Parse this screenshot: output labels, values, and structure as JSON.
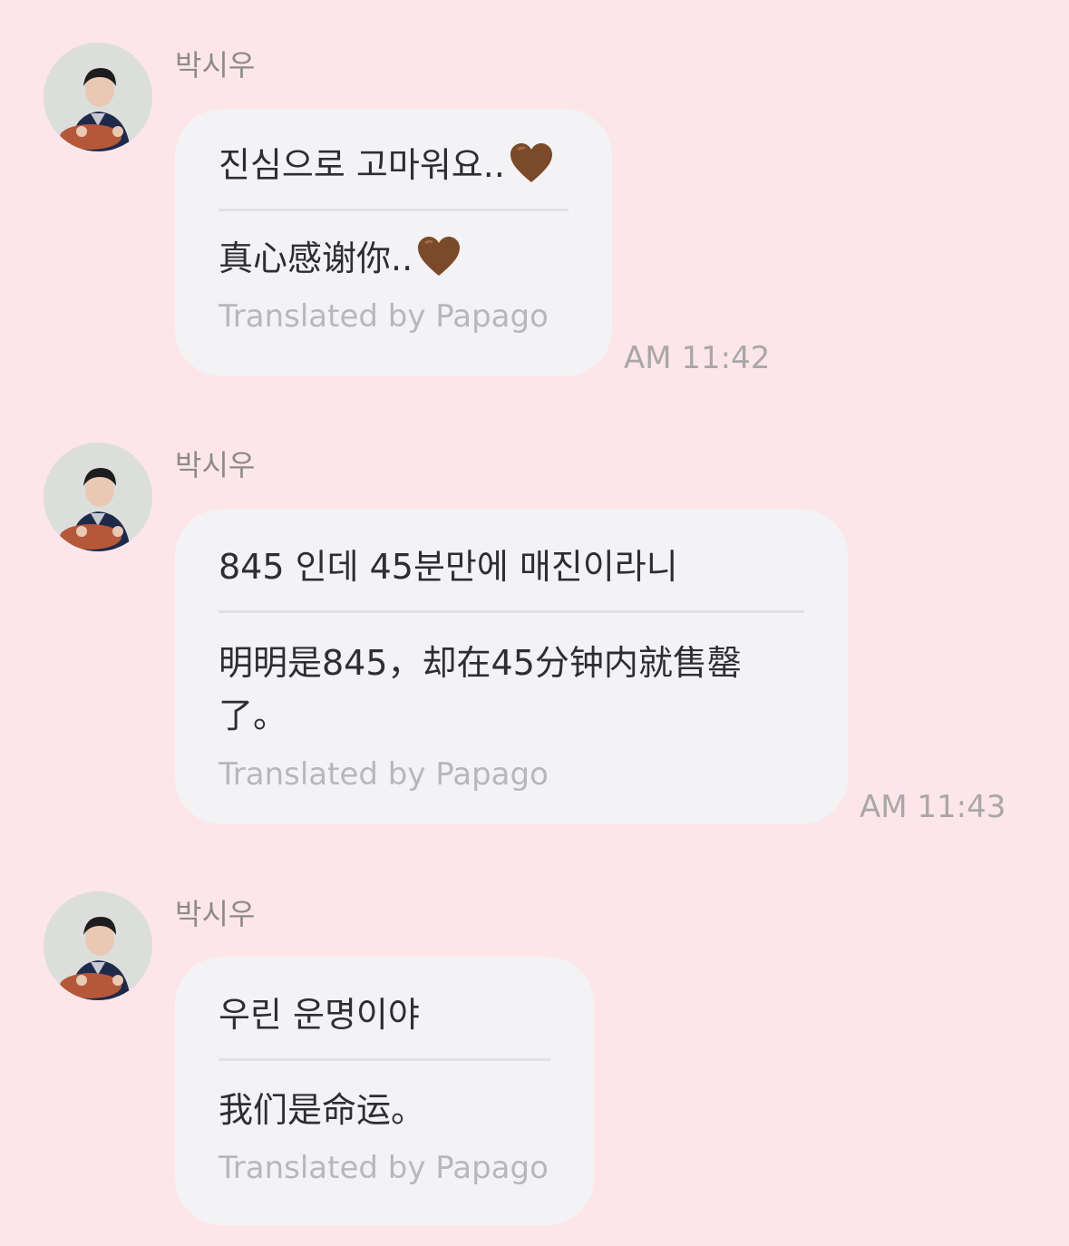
{
  "messages": [
    {
      "sender": "박시우",
      "original": "진심으로 고마워요..",
      "translation": "真心感谢你..",
      "credit": "Translated by Papago",
      "time": "AM 11:42",
      "emoji": "brown-heart-icon"
    },
    {
      "sender": "박시우",
      "original": "845 인데 45분만에 매진이라니",
      "translation": "明明是845，却在45分钟内就售罄了。",
      "credit": "Translated by Papago",
      "time": "AM 11:43"
    },
    {
      "sender": "박시우",
      "original": "우린 운명이야",
      "translation": "我们是命运。",
      "credit": "Translated by Papago"
    }
  ],
  "colors": {
    "background": "#fde6e9",
    "bubble": "#f3f2f4",
    "heart": "#7a4a2a"
  }
}
